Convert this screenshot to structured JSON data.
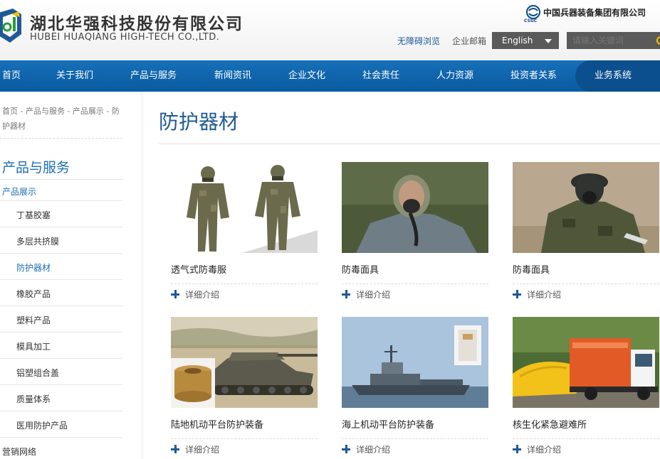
{
  "header": {
    "brand_cn": "湖北华强科技股份有限公司",
    "brand_en": "HUBEI HUAQIANG HIGH-TECH CO.,LTD.",
    "group_logo_text": "CSGC",
    "group_name": "中国兵器装备集团有限公司",
    "accessibility_link": "无障碍浏览",
    "mail_link": "企业邮箱",
    "language": "English",
    "search_placeholder": "请输入关键词"
  },
  "nav": {
    "items": [
      "首页",
      "关于我们",
      "产品与服务",
      "新闻资讯",
      "企业文化",
      "社会责任",
      "人力资源",
      "投资者关系"
    ],
    "system": "业务系统"
  },
  "sidebar": {
    "breadcrumb": "首页 - 产品与服务 - 产品展示 - 防护器材",
    "title": "产品与服务",
    "subtitle": "产品展示",
    "items": [
      "丁基胶塞",
      "多层共挤膜",
      "防护器材",
      "橡胶产品",
      "塑料产品",
      "模具加工",
      "铝塑组合盖",
      "质量体系",
      "医用防护产品"
    ],
    "active": "防护器材",
    "bottom": "营销网络"
  },
  "main": {
    "title": "防护器材",
    "more_label": "详细介绍",
    "products": [
      {
        "name": "透气式防毒服",
        "icon": "protective-suit-photo"
      },
      {
        "name": "防毒面具",
        "icon": "gas-mask-photo"
      },
      {
        "name": "防毒面具",
        "icon": "gas-mask-photo"
      },
      {
        "name": "陆地机动平台防护装备",
        "icon": "tank-photo"
      },
      {
        "name": "海上机动平台防护装备",
        "icon": "ship-photo"
      },
      {
        "name": "核生化紧急避难所",
        "icon": "truck-photo"
      }
    ]
  },
  "colors": {
    "nav_blue": "#0a5aa1",
    "accent_blue": "#1e6fb2",
    "title_blue": "#1e5a96"
  }
}
